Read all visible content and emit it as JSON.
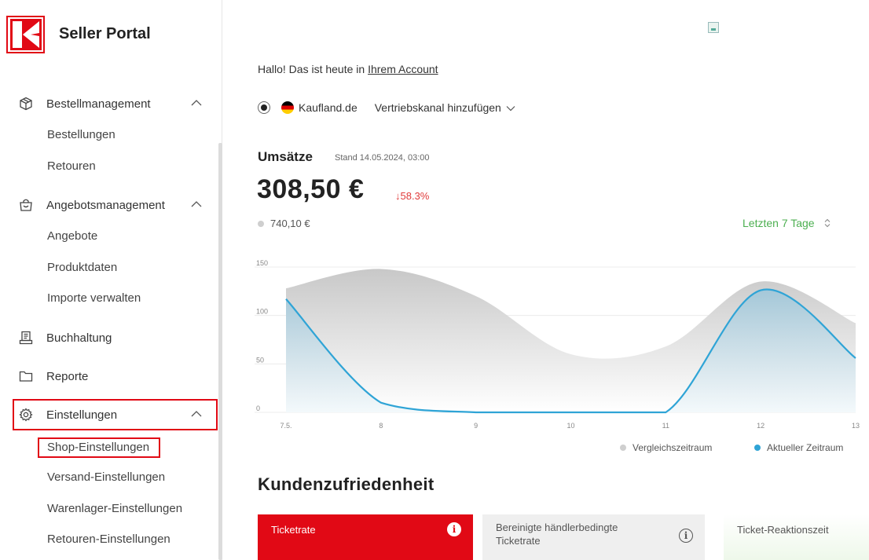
{
  "app": {
    "brand": "Seller Portal"
  },
  "sidebar": {
    "groups": [
      {
        "label": "Bestellmanagement",
        "icon": "package-icon",
        "items": [
          "Bestellungen",
          "Retouren"
        ]
      },
      {
        "label": "Angebotsmanagement",
        "icon": "offer-bag-icon",
        "items": [
          "Angebote",
          "Produktdaten",
          "Importe verwalten"
        ]
      },
      {
        "label": "Buchhaltung",
        "icon": "accounting-icon",
        "items": []
      },
      {
        "label": "Reporte",
        "icon": "folder-icon",
        "items": []
      },
      {
        "label": "Einstellungen",
        "icon": "gear-icon",
        "items": [
          "Shop-Einstellungen",
          "Versand-Einstellungen",
          "Warenlager-Einstellungen",
          "Retouren-Einstellungen"
        ]
      }
    ]
  },
  "main": {
    "greeting_prefix": "Hallo! Das ist heute in ",
    "greeting_link": "Ihrem Account",
    "channel": {
      "name": "Kaufland.de",
      "add_label": "Vertriebskanal hinzufügen"
    },
    "sales": {
      "title": "Umsätze",
      "stand": "Stand 14.05.2024, 03:00",
      "value": "308,50 €",
      "change": "↓58.3%",
      "compare_value": "740,10 €",
      "range_label": "Letzten 7 Tage"
    },
    "legend": {
      "compare": "Vergleichszeitraum",
      "current": "Aktueller Zeitraum"
    },
    "satisfaction": {
      "title": "Kundenzufriedenheit",
      "cards": [
        {
          "label": "Ticketrate"
        },
        {
          "label": "Bereinigte händlerbedingte Ticketrate"
        },
        {
          "label": "Ticket-Reaktionszeit"
        }
      ]
    }
  },
  "colors": {
    "accent": "#e10915",
    "current": "#2fa4d6",
    "compare": "#cfcfcf",
    "positive": "#4caf50",
    "negative": "#e03a3a"
  },
  "chart_data": {
    "type": "area",
    "x": [
      "7.5.",
      "8",
      "9",
      "10",
      "11",
      "12",
      "13"
    ],
    "yticks": [
      "0",
      "50",
      "100",
      "150"
    ],
    "ylim": [
      0,
      150
    ],
    "series": [
      {
        "name": "Vergleichszeitraum",
        "values": [
          128,
          148,
          120,
          60,
          68,
          135,
          92
        ]
      },
      {
        "name": "Aktueller Zeitraum",
        "values": [
          117,
          10,
          0,
          0,
          0,
          126,
          56
        ]
      }
    ],
    "legend_position": "bottom-right",
    "grid": true
  }
}
